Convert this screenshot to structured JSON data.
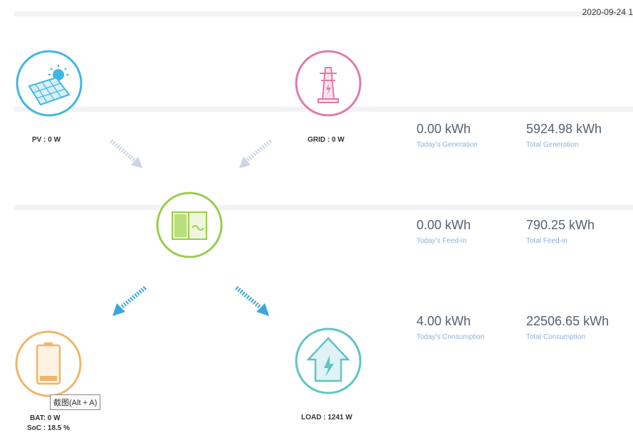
{
  "header": {
    "datetime": "2020-09-24 1"
  },
  "flow": {
    "pv": {
      "label": "PV : 0 W",
      "color": "#3eb8e0"
    },
    "grid": {
      "label": "GRID : 0 W",
      "color": "#e27aa9"
    },
    "inverter": {
      "color": "#9acd4c"
    },
    "battery": {
      "label": "BAT:  0 W",
      "soc": "SoC : 18.5 %",
      "color": "#f0b56a"
    },
    "load": {
      "label": "LOAD : 1241 W",
      "color": "#5fc4c6"
    }
  },
  "stats": {
    "today_generation": {
      "value": "0.00 kWh",
      "caption": "Today's Generation"
    },
    "total_generation": {
      "value": "5924.98 kWh",
      "caption": "Total Generation"
    },
    "today_feed_in": {
      "value": "0.00 kWh",
      "caption": "Today's Feed-in"
    },
    "total_feed_in": {
      "value": "790.25 kWh",
      "caption": "Total Feed-in"
    },
    "today_consumption": {
      "value": "4.00 kWh",
      "caption": "Today's Consumption"
    },
    "total_consumption": {
      "value": "22506.65 kWh",
      "caption": "Total Consumption"
    }
  },
  "tooltip": {
    "text": "截图(Alt + A)"
  }
}
